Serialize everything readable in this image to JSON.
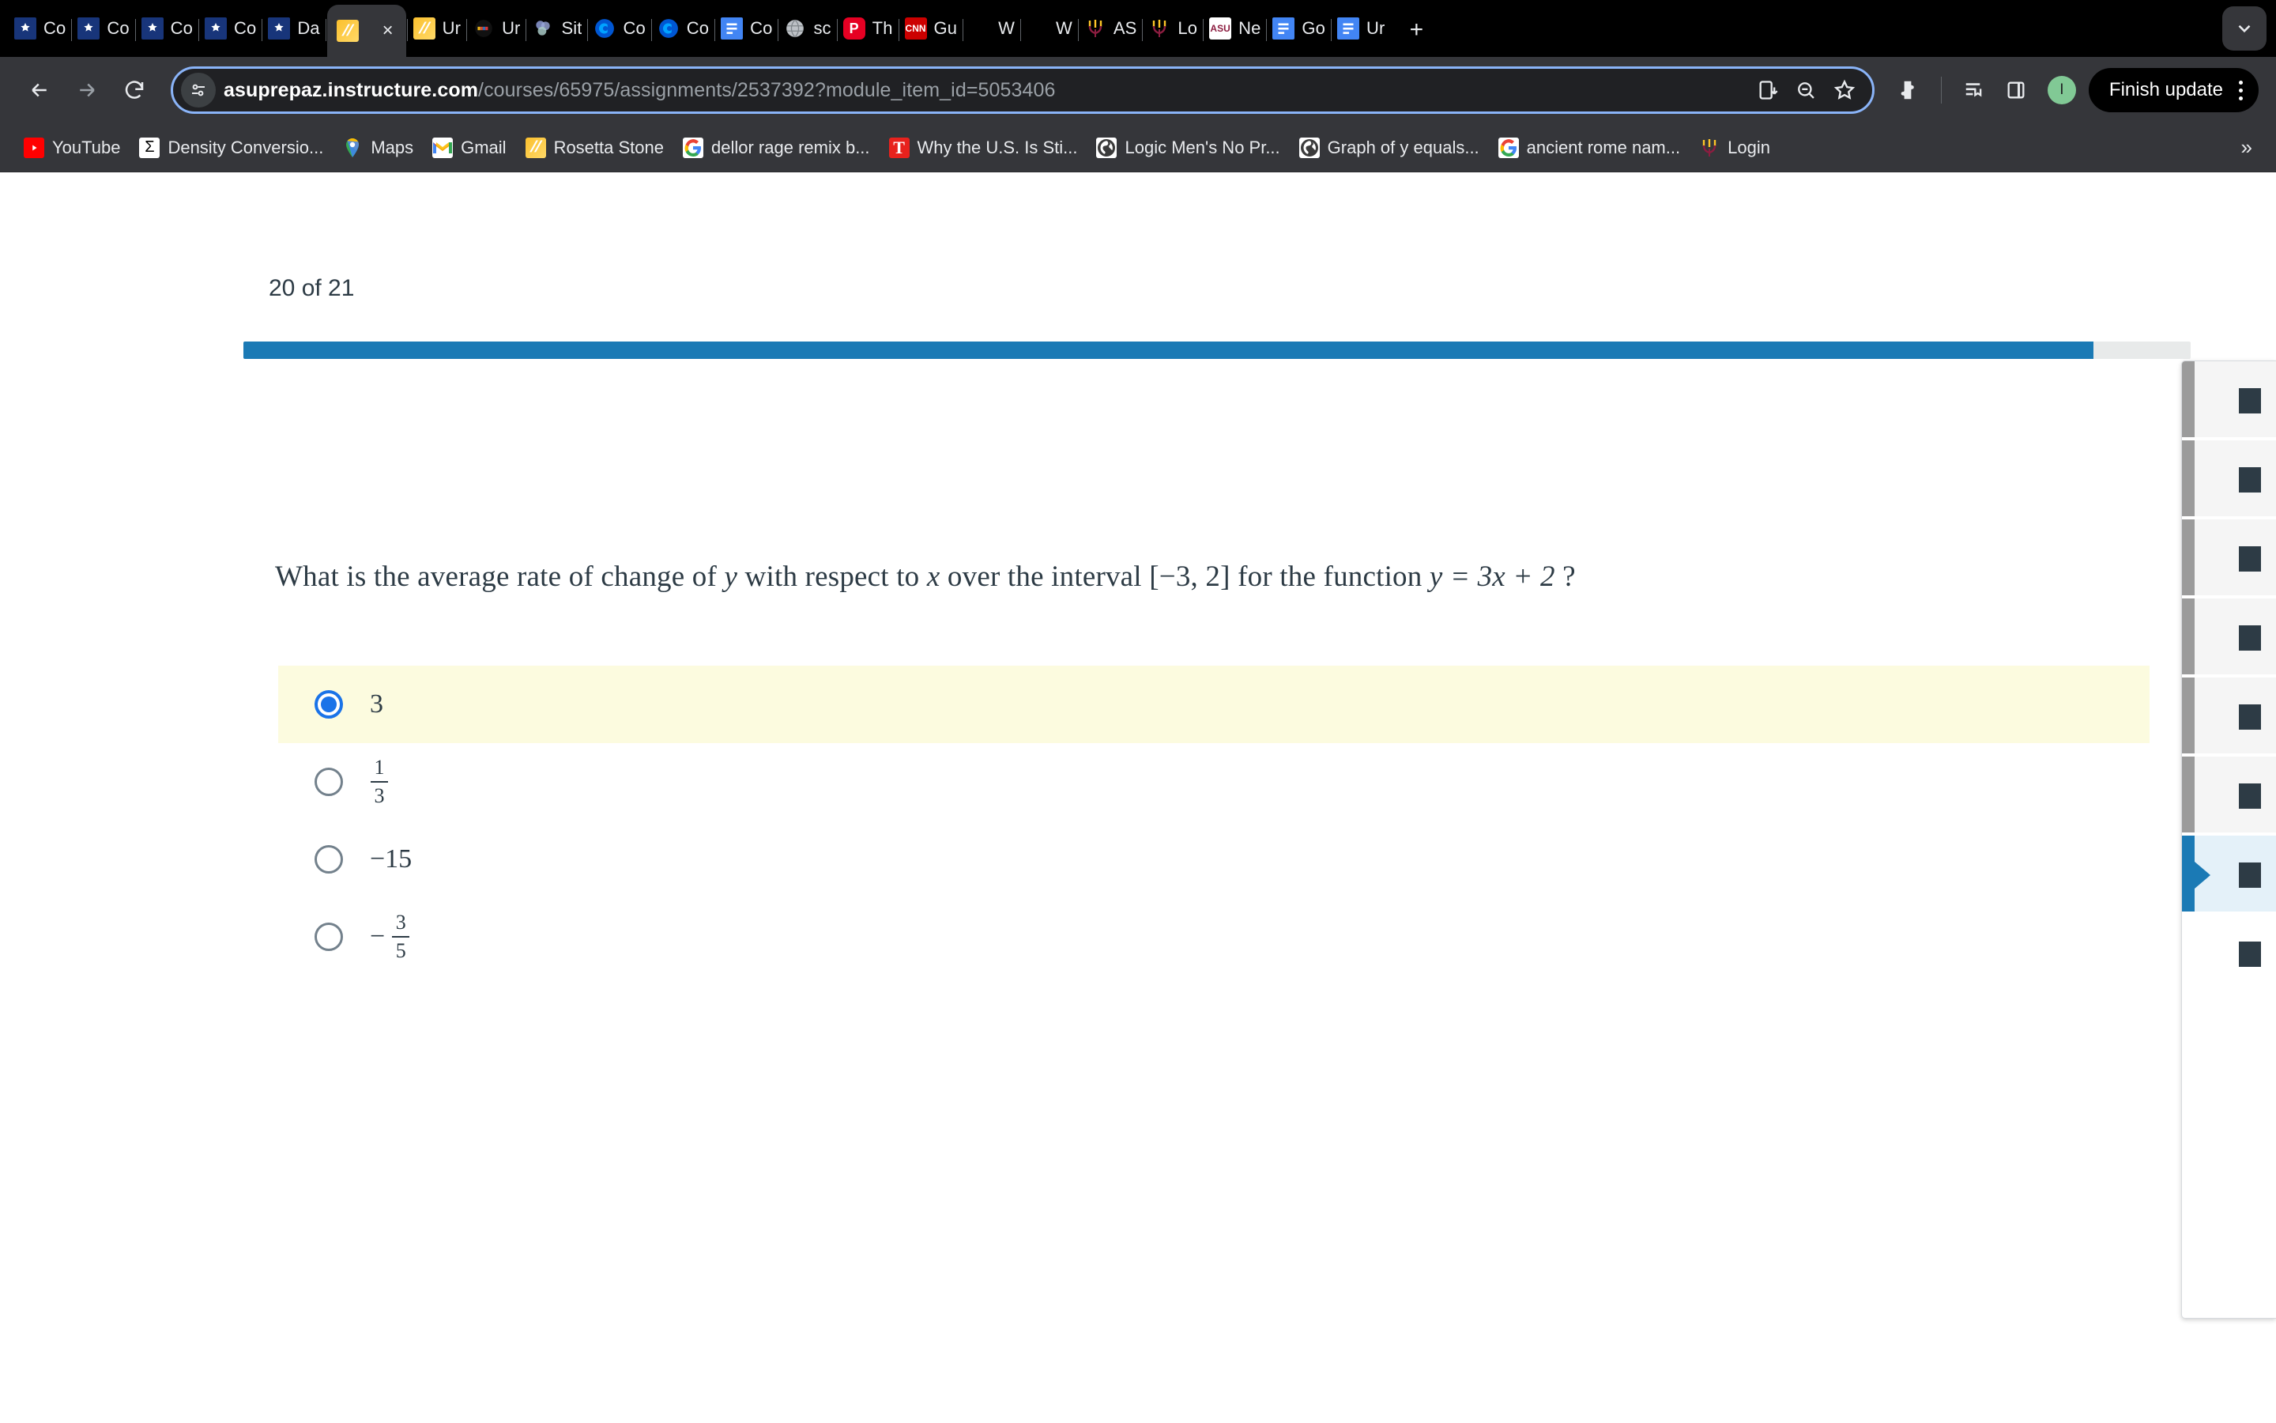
{
  "browser": {
    "tabs": [
      {
        "title": "Co",
        "icon": "canvas-icon",
        "active": false
      },
      {
        "title": "Co",
        "icon": "canvas-icon",
        "active": false
      },
      {
        "title": "Co",
        "icon": "canvas-icon",
        "active": false
      },
      {
        "title": "Co",
        "icon": "canvas-icon",
        "active": false
      },
      {
        "title": "Da",
        "icon": "canvas-icon",
        "active": false
      },
      {
        "title": "",
        "icon": "rosetta-stone-icon",
        "active": true
      },
      {
        "title": "Ur",
        "icon": "rosetta-stone-icon",
        "active": false
      },
      {
        "title": "Ur",
        "icon": "unsplash-icon",
        "active": false
      },
      {
        "title": "Sit",
        "icon": "sites-icon",
        "active": false
      },
      {
        "title": "Co",
        "icon": "coursera-icon",
        "active": false
      },
      {
        "title": "Co",
        "icon": "coursera-icon",
        "active": false
      },
      {
        "title": "Co",
        "icon": "google-docs-icon",
        "active": false
      },
      {
        "title": "sc",
        "icon": "globe-gray-icon",
        "active": false
      },
      {
        "title": "Th",
        "icon": "pinterest-icon",
        "active": false
      },
      {
        "title": "Gu",
        "icon": "cnn-icon",
        "active": false
      },
      {
        "title": "W",
        "icon": "blank-icon",
        "active": false
      },
      {
        "title": "W",
        "icon": "blank-icon",
        "active": false
      },
      {
        "title": "AS",
        "icon": "asu-pitchfork-icon",
        "active": false
      },
      {
        "title": "Lo",
        "icon": "asu-pitchfork-icon",
        "active": false
      },
      {
        "title": "Ne",
        "icon": "asu-logo-icon",
        "active": false
      },
      {
        "title": "Go",
        "icon": "google-doc-icon",
        "active": false
      },
      {
        "title": "Ur",
        "icon": "google-docs-icon",
        "active": false
      }
    ],
    "new_tab_label": "+",
    "tab_close_label": "×",
    "tabstrip_expand_icon": "chevron-down-icon",
    "nav": {
      "back_icon": "arrow-left-icon",
      "forward_icon": "arrow-right-icon",
      "reload_icon": "reload-icon"
    },
    "omnibox": {
      "site_info_icon": "page-info-icon",
      "host": "asuprepaz.instructure.com",
      "path": "/courses/65975/assignments/2537392?module_item_id=5053406",
      "install_icon": "install-app-icon",
      "zoom_out_icon": "zoom-out-icon",
      "bookmark_icon": "star-icon"
    },
    "toolbar_icons": [
      "extensions-icon",
      "reading-list-icon",
      "side-panel-icon"
    ],
    "avatar_letter": "I",
    "update_button_label": "Finish update",
    "menu_icon": "kebab-menu-icon"
  },
  "bookmarks": {
    "items": [
      {
        "label": "YouTube",
        "icon": "youtube-icon"
      },
      {
        "label": "Density Conversio...",
        "icon": "sigma-icon"
      },
      {
        "label": "Maps",
        "icon": "google-maps-icon"
      },
      {
        "label": "Gmail",
        "icon": "gmail-icon"
      },
      {
        "label": "Rosetta Stone",
        "icon": "rosetta-stone-icon"
      },
      {
        "label": "dellor rage remix b...",
        "icon": "google-icon"
      },
      {
        "label": "Why the U.S. Is Sti...",
        "icon": "time-icon"
      },
      {
        "label": "Logic Men's No Pr...",
        "icon": "globe-icon"
      },
      {
        "label": "Graph of y equals...",
        "icon": "globe-icon"
      },
      {
        "label": "ancient rome nam...",
        "icon": "google-icon"
      },
      {
        "label": "Login",
        "icon": "asu-pitchfork-icon"
      }
    ],
    "overflow_icon": "»"
  },
  "quiz": {
    "counter": "20 of 21",
    "progress_percent": 95,
    "question": {
      "part1": "What is the average rate of change of ",
      "var_y": "y",
      "part2": " with respect to ",
      "var_x": "x",
      "part3": " over the interval ",
      "interval": "[−3, 2]",
      "part4": " for the function ",
      "function": "y = 3x + 2",
      "part5": " ?"
    },
    "options": [
      {
        "id": "a",
        "kind": "plain",
        "text": "3",
        "selected": true
      },
      {
        "id": "b",
        "kind": "fraction",
        "numerator": "1",
        "denominator": "3",
        "sign": "",
        "selected": false
      },
      {
        "id": "c",
        "kind": "plain",
        "text": "−15",
        "selected": false
      },
      {
        "id": "d",
        "kind": "fraction",
        "numerator": "3",
        "denominator": "5",
        "sign": "−",
        "selected": false
      }
    ],
    "highlight_color": "#fcfbdf",
    "accent_color": "#1b7ab5",
    "radio_selected_color": "#1a73e8"
  },
  "question_list": {
    "items": [
      {
        "state": "answered"
      },
      {
        "state": "answered"
      },
      {
        "state": "answered"
      },
      {
        "state": "answered"
      },
      {
        "state": "answered"
      },
      {
        "state": "answered"
      },
      {
        "state": "current"
      },
      {
        "state": "unanswered"
      }
    ]
  }
}
